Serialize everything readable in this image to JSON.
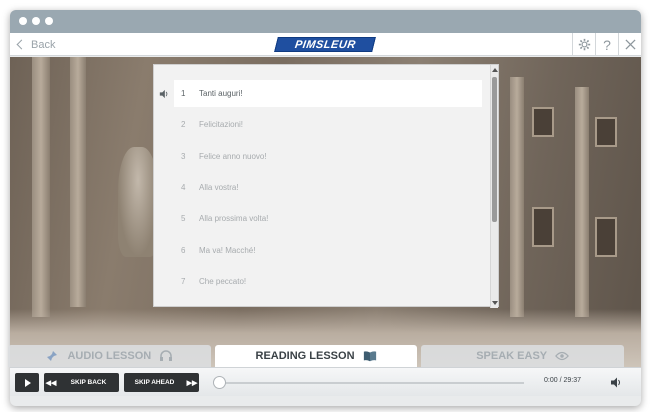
{
  "toolbar": {
    "back_label": "Back",
    "logo_text": "PIMSLEUR",
    "settings_icon": "gear-icon",
    "help_label": "?",
    "close_icon": "close-icon"
  },
  "phrases": {
    "items": [
      {
        "num": "1",
        "text": "Tanti auguri!",
        "active": true
      },
      {
        "num": "2",
        "text": "Felicitazioni!",
        "active": false
      },
      {
        "num": "3",
        "text": "Felice anno nuovo!",
        "active": false
      },
      {
        "num": "4",
        "text": "Alla vostra!",
        "active": false
      },
      {
        "num": "5",
        "text": "Alla prossima volta!",
        "active": false
      },
      {
        "num": "6",
        "text": "Ma va! Macché!",
        "active": false
      },
      {
        "num": "7",
        "text": "Che peccato!",
        "active": false
      }
    ]
  },
  "tabs": {
    "audio": "AUDIO LESSON",
    "reading": "READING LESSON",
    "speak": "SPEAK EASY",
    "active": "reading"
  },
  "player": {
    "skip_back": "SKIP BACK",
    "skip_ahead": "SKIP AHEAD",
    "time": "0:00 / 29:37",
    "progress": 0
  },
  "colors": {
    "logo_blue": "#1f4fa0",
    "titlebar": "#9aa8b1",
    "control_dark": "#2f3234"
  }
}
